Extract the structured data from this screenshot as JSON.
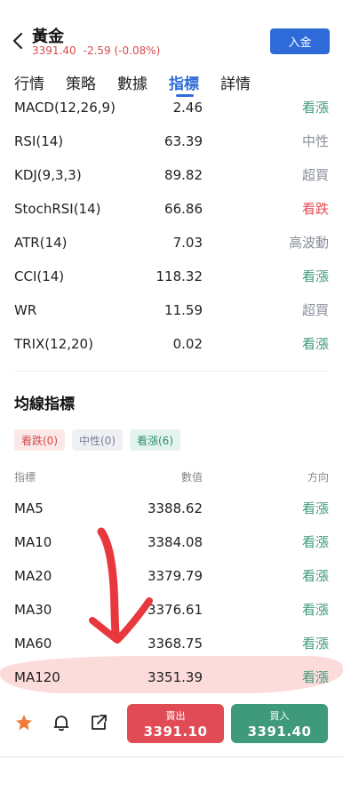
{
  "header": {
    "title": "黃金",
    "price": "3391.40",
    "change": "-2.59 (-0.08%)",
    "deposit_label": "入金"
  },
  "tabs": [
    {
      "label": "行情"
    },
    {
      "label": "策略"
    },
    {
      "label": "數據"
    },
    {
      "label": "指標"
    },
    {
      "label": "詳情"
    }
  ],
  "indicators": [
    {
      "name": "MACD(12,26,9)",
      "value": "2.46",
      "signal": "看漲"
    },
    {
      "name": "RSI(14)",
      "value": "63.39",
      "signal": "中性"
    },
    {
      "name": "KDJ(9,3,3)",
      "value": "89.82",
      "signal": "超買"
    },
    {
      "name": "StochRSI(14)",
      "value": "66.86",
      "signal": "看跌"
    },
    {
      "name": "ATR(14)",
      "value": "7.03",
      "signal": "高波動"
    },
    {
      "name": "CCI(14)",
      "value": "118.32",
      "signal": "看漲"
    },
    {
      "name": "WR",
      "value": "11.59",
      "signal": "超買"
    },
    {
      "name": "TRIX(12,20)",
      "value": "0.02",
      "signal": "看漲"
    }
  ],
  "ma_section": {
    "title": "均線指標",
    "chips": {
      "bear": "看跌(0)",
      "neutral": "中性(0)",
      "bull": "看漲(6)"
    },
    "columns": {
      "indicator": "指標",
      "value": "數值",
      "direction": "方向"
    },
    "rows": [
      {
        "name": "MA5",
        "value": "3388.62",
        "signal": "看漲"
      },
      {
        "name": "MA10",
        "value": "3384.08",
        "signal": "看漲"
      },
      {
        "name": "MA20",
        "value": "3379.79",
        "signal": "看漲"
      },
      {
        "name": "MA30",
        "value": "3376.61",
        "signal": "看漲"
      },
      {
        "name": "MA60",
        "value": "3368.75",
        "signal": "看漲"
      },
      {
        "name": "MA120",
        "value": "3351.39",
        "signal": "看漲"
      }
    ]
  },
  "bottom": {
    "sell_label": "賣出",
    "sell_price": "3391.10",
    "buy_label": "買入",
    "buy_price": "3391.40"
  },
  "colors": {
    "accent": "#2f6bd8",
    "bull": "#3f9a7c",
    "bear": "#e14b55",
    "neutral": "#8a8f99",
    "annotation": "#e8383d"
  },
  "icons": [
    "chevron-left-icon",
    "star-icon",
    "bell-icon",
    "share-icon"
  ]
}
